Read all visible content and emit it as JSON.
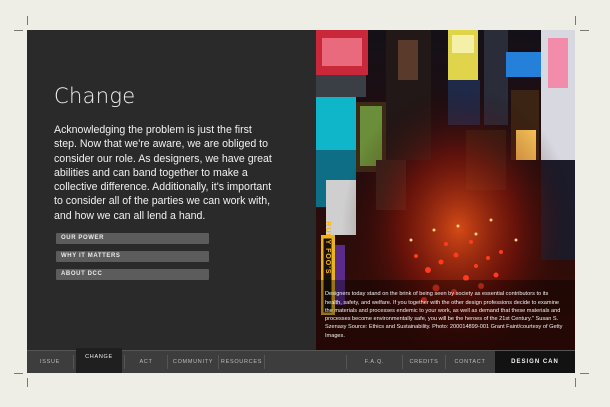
{
  "page": {
    "title": "Change",
    "body": "Acknowledging the problem is just the first step. Now that we're aware, we are obliged to consider our role. As designers, we have great abilities and can band together to make a collective difference. Additionally, it's important to consider all of the parties we can work with, and how we can all lend a hand."
  },
  "subnav": [
    {
      "label": "OUR POWER"
    },
    {
      "label": "WHY IT MATTERS"
    },
    {
      "label": "ABOUT DCC"
    }
  ],
  "photo": {
    "caption": "Designers today stand on the brink of being seen by society as essential contributors to its health, safety, and welfare. If you together with the other design professions decide to examine the materials and processes endemic to your work, as well as demand that these materials and processes become environmentally safe, you will be the heroes of the 21st Century.\" Susan S. Szenasy Source: Ethics and Sustainability. Photo: 200014899-001 Grant Faint/courtesy of Getty Images.",
    "sign_text": "RUBY FOO'S"
  },
  "nav": {
    "items": [
      {
        "label": "ISSUE"
      },
      {
        "label": "CHANGE"
      },
      {
        "label": "ACT"
      },
      {
        "label": "COMMUNITY"
      },
      {
        "label": "RESOURCES"
      },
      {
        "label": "F.A.Q."
      },
      {
        "label": "CREDITS"
      },
      {
        "label": "CONTACT"
      }
    ],
    "logo": "DESIGN CAN 3DNAHƆ"
  },
  "colors": {
    "panel": "#2a2a2a",
    "button": "#5c5c5c",
    "nav_bar": "#3d3d3d",
    "background": "#efeee6"
  }
}
